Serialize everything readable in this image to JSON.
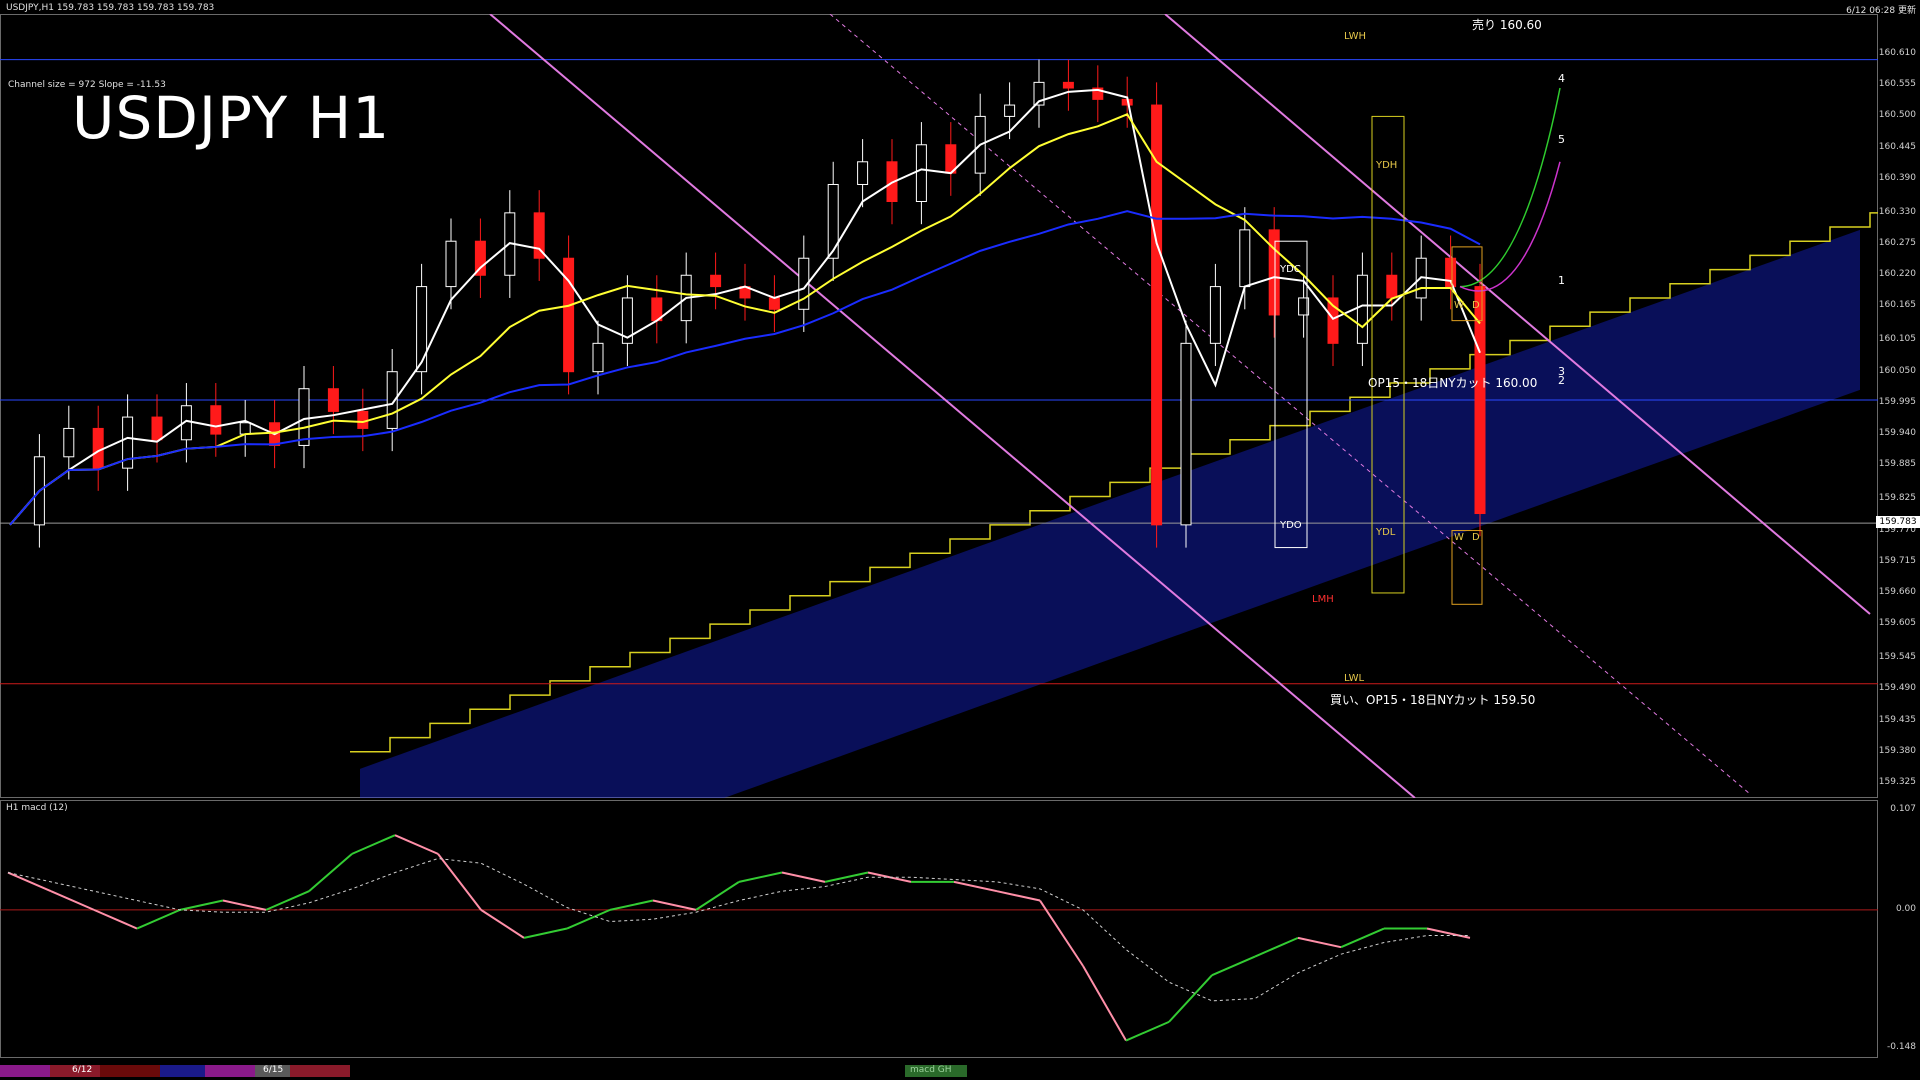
{
  "header": {
    "symbol_info": "USDJPY,H1  159.783 159.783 159.783 159.783",
    "datetime": "6/12 06:28 更新"
  },
  "chart": {
    "title": "USDJPY H1",
    "channel_info": "Channel size = 972  Slope = -11.53",
    "sell_note": "売り 160.60",
    "op_note": "OP15・18日NYカット 160.00",
    "buy_note": "買い、OP15・18日NYカット 159.50",
    "current_price": "159.783",
    "level_labels": [
      "YDC",
      "YDO",
      "YDH",
      "YDL",
      "LWH",
      "LWL",
      "LMH",
      "W",
      "D",
      "W",
      "D"
    ],
    "wave_labels": [
      "1",
      "2",
      "3",
      "4",
      "5"
    ]
  },
  "macd": {
    "label": "H1  macd (12)",
    "tab_label": "macd GH"
  },
  "dates": [
    "6/12",
    "6/15"
  ],
  "colors": {
    "background": "#000000",
    "bull": "#ffffff",
    "bear": "#ff1a1a",
    "ma_white": "#ffffff",
    "ma_yellow": "#ffff33",
    "ma_blue": "#1a2cff",
    "cloud": "#1a2cff",
    "trend": "#e07ae0",
    "macd_up": "#33cc33",
    "macd_down": "#ff8fa8"
  },
  "chart_data": {
    "type": "candlestick",
    "symbol": "USDJPY",
    "timeframe": "H1",
    "price_ticks": [
      "160.610",
      "160.555",
      "160.500",
      "160.445",
      "160.390",
      "160.330",
      "160.275",
      "160.220",
      "160.165",
      "160.105",
      "160.050",
      "159.995",
      "159.940",
      "159.885",
      "159.825",
      "159.770",
      "159.715",
      "159.660",
      "159.605",
      "159.545",
      "159.490",
      "159.435",
      "159.380",
      "159.325"
    ],
    "ylim": [
      159.325,
      160.61
    ],
    "macd_ticks": [
      "0.107",
      "0.00",
      "-0.148"
    ],
    "levels": {
      "sell": 160.6,
      "op_cut": 160.0,
      "buy": 159.5,
      "current": 159.783
    },
    "close_series": [
      159.78,
      159.9,
      159.95,
      159.88,
      159.97,
      159.93,
      159.99,
      159.94,
      159.96,
      159.92,
      160.02,
      159.98,
      159.95,
      160.05,
      160.2,
      160.28,
      160.22,
      160.33,
      160.25,
      160.05,
      160.1,
      160.18,
      160.14,
      160.22,
      160.2,
      160.18,
      160.16,
      160.25,
      160.38,
      160.42,
      160.35,
      160.45,
      160.4,
      160.5,
      160.52,
      160.56,
      160.55,
      160.53,
      160.52,
      159.78,
      160.1,
      160.2,
      160.3,
      160.15,
      160.18,
      160.1,
      160.22,
      160.18,
      160.25,
      160.2,
      159.8
    ],
    "macd_series": [
      0.04,
      0.02,
      0.0,
      -0.02,
      0.0,
      0.01,
      0.0,
      0.02,
      0.06,
      0.08,
      0.06,
      0.0,
      -0.03,
      -0.02,
      0.0,
      0.01,
      0.0,
      0.03,
      0.04,
      0.03,
      0.04,
      0.03,
      0.03,
      0.02,
      0.01,
      -0.06,
      -0.14,
      -0.12,
      -0.07,
      -0.05,
      -0.03,
      -0.04,
      -0.02,
      -0.02,
      -0.03
    ]
  }
}
